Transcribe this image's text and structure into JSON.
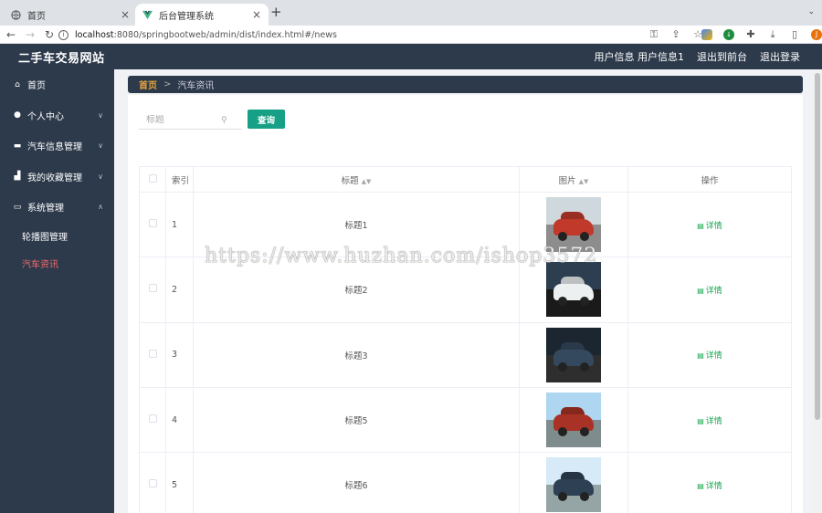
{
  "browser": {
    "tabs": [
      {
        "title": "首页",
        "active": false
      },
      {
        "title": "后台管理系统",
        "active": true
      }
    ],
    "url_host": "localhost",
    "url_rest": ":8080/springbootweb/admin/dist/index.html#/news",
    "profile_initial": "J"
  },
  "app": {
    "title": "二手车交易网站",
    "header_links": [
      "用户信息 用户信息1",
      "退出到前台",
      "退出登录"
    ]
  },
  "sidebar": {
    "items": [
      {
        "label": "首页",
        "icon": "home-icon",
        "has_arrow": false
      },
      {
        "label": "个人中心",
        "icon": "user-icon",
        "has_arrow": true
      },
      {
        "label": "汽车信息管理",
        "icon": "monitor-icon",
        "has_arrow": true
      },
      {
        "label": "我的收藏管理",
        "icon": "chart-icon",
        "has_arrow": true
      },
      {
        "label": "系统管理",
        "icon": "system-icon",
        "has_arrow": true,
        "expanded": true
      }
    ],
    "sub_items": [
      {
        "label": "轮播图管理",
        "active": false
      },
      {
        "label": "汽车资讯",
        "active": true
      }
    ]
  },
  "breadcrumb": {
    "home": "首页",
    "separator": ">",
    "current": "汽车资讯"
  },
  "search": {
    "placeholder": "标题",
    "button": "查询"
  },
  "table": {
    "headers": {
      "index": "索引",
      "title": "标题",
      "image": "图片",
      "action": "操作"
    },
    "action_label": "详情",
    "rows": [
      {
        "index": "1",
        "title": "标题1",
        "car_color": "#c0392b",
        "sky": "#cfd8dc",
        "ground": "#8d8d8d"
      },
      {
        "index": "2",
        "title": "标题2",
        "car_color": "#ecf0f1",
        "sky": "#2c3e50",
        "ground": "#1a1a1a"
      },
      {
        "index": "3",
        "title": "标题3",
        "car_color": "#34495e",
        "sky": "#1b2631",
        "ground": "#2e2e2e"
      },
      {
        "index": "4",
        "title": "标题5",
        "car_color": "#a93226",
        "sky": "#aed6f1",
        "ground": "#7f8c8d"
      },
      {
        "index": "5",
        "title": "标题6",
        "car_color": "#2e4053",
        "sky": "#d6eaf8",
        "ground": "#95a5a6"
      }
    ]
  },
  "watermark": "https://www.huzhan.com/ishop3572"
}
